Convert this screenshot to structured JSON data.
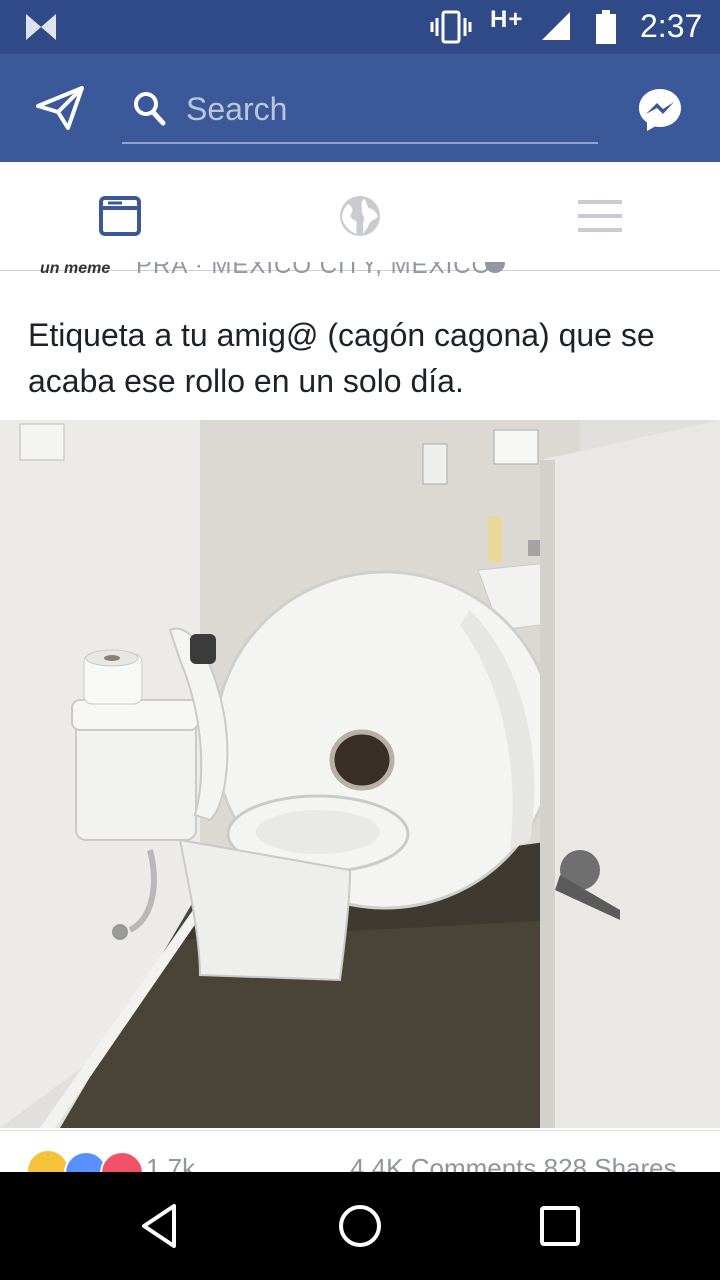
{
  "status_bar": {
    "network": "H+",
    "time": "2:37"
  },
  "header": {
    "search_placeholder": "Search"
  },
  "post": {
    "page_name": "un meme",
    "location": "PRA · MEXICO CITY, MEXICO",
    "text": "Etiqueta a tu amig@ (cagón cagona) que se acaba ese rollo en un solo día.",
    "reactions_count": "1.7k",
    "stats": "4.4K Comments 828 Shares"
  },
  "colors": {
    "brand": "#3b5998",
    "status_bar": "#2f4a86",
    "like": "#5890ff",
    "love": "#f25268",
    "haha": "#f7c23b"
  }
}
